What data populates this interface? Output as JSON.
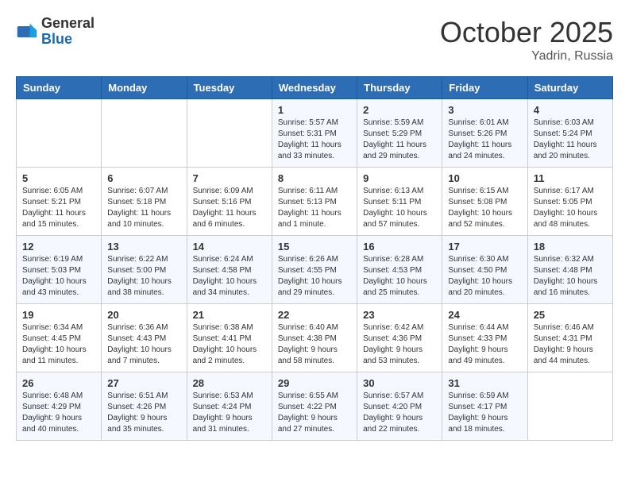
{
  "logo": {
    "general": "General",
    "blue": "Blue"
  },
  "title": "October 2025",
  "location": "Yadrin, Russia",
  "days_of_week": [
    "Sunday",
    "Monday",
    "Tuesday",
    "Wednesday",
    "Thursday",
    "Friday",
    "Saturday"
  ],
  "weeks": [
    [
      {
        "day": "",
        "info": ""
      },
      {
        "day": "",
        "info": ""
      },
      {
        "day": "",
        "info": ""
      },
      {
        "day": "1",
        "info": "Sunrise: 5:57 AM\nSunset: 5:31 PM\nDaylight: 11 hours\nand 33 minutes."
      },
      {
        "day": "2",
        "info": "Sunrise: 5:59 AM\nSunset: 5:29 PM\nDaylight: 11 hours\nand 29 minutes."
      },
      {
        "day": "3",
        "info": "Sunrise: 6:01 AM\nSunset: 5:26 PM\nDaylight: 11 hours\nand 24 minutes."
      },
      {
        "day": "4",
        "info": "Sunrise: 6:03 AM\nSunset: 5:24 PM\nDaylight: 11 hours\nand 20 minutes."
      }
    ],
    [
      {
        "day": "5",
        "info": "Sunrise: 6:05 AM\nSunset: 5:21 PM\nDaylight: 11 hours\nand 15 minutes."
      },
      {
        "day": "6",
        "info": "Sunrise: 6:07 AM\nSunset: 5:18 PM\nDaylight: 11 hours\nand 10 minutes."
      },
      {
        "day": "7",
        "info": "Sunrise: 6:09 AM\nSunset: 5:16 PM\nDaylight: 11 hours\nand 6 minutes."
      },
      {
        "day": "8",
        "info": "Sunrise: 6:11 AM\nSunset: 5:13 PM\nDaylight: 11 hours\nand 1 minute."
      },
      {
        "day": "9",
        "info": "Sunrise: 6:13 AM\nSunset: 5:11 PM\nDaylight: 10 hours\nand 57 minutes."
      },
      {
        "day": "10",
        "info": "Sunrise: 6:15 AM\nSunset: 5:08 PM\nDaylight: 10 hours\nand 52 minutes."
      },
      {
        "day": "11",
        "info": "Sunrise: 6:17 AM\nSunset: 5:05 PM\nDaylight: 10 hours\nand 48 minutes."
      }
    ],
    [
      {
        "day": "12",
        "info": "Sunrise: 6:19 AM\nSunset: 5:03 PM\nDaylight: 10 hours\nand 43 minutes."
      },
      {
        "day": "13",
        "info": "Sunrise: 6:22 AM\nSunset: 5:00 PM\nDaylight: 10 hours\nand 38 minutes."
      },
      {
        "day": "14",
        "info": "Sunrise: 6:24 AM\nSunset: 4:58 PM\nDaylight: 10 hours\nand 34 minutes."
      },
      {
        "day": "15",
        "info": "Sunrise: 6:26 AM\nSunset: 4:55 PM\nDaylight: 10 hours\nand 29 minutes."
      },
      {
        "day": "16",
        "info": "Sunrise: 6:28 AM\nSunset: 4:53 PM\nDaylight: 10 hours\nand 25 minutes."
      },
      {
        "day": "17",
        "info": "Sunrise: 6:30 AM\nSunset: 4:50 PM\nDaylight: 10 hours\nand 20 minutes."
      },
      {
        "day": "18",
        "info": "Sunrise: 6:32 AM\nSunset: 4:48 PM\nDaylight: 10 hours\nand 16 minutes."
      }
    ],
    [
      {
        "day": "19",
        "info": "Sunrise: 6:34 AM\nSunset: 4:45 PM\nDaylight: 10 hours\nand 11 minutes."
      },
      {
        "day": "20",
        "info": "Sunrise: 6:36 AM\nSunset: 4:43 PM\nDaylight: 10 hours\nand 7 minutes."
      },
      {
        "day": "21",
        "info": "Sunrise: 6:38 AM\nSunset: 4:41 PM\nDaylight: 10 hours\nand 2 minutes."
      },
      {
        "day": "22",
        "info": "Sunrise: 6:40 AM\nSunset: 4:38 PM\nDaylight: 9 hours\nand 58 minutes."
      },
      {
        "day": "23",
        "info": "Sunrise: 6:42 AM\nSunset: 4:36 PM\nDaylight: 9 hours\nand 53 minutes."
      },
      {
        "day": "24",
        "info": "Sunrise: 6:44 AM\nSunset: 4:33 PM\nDaylight: 9 hours\nand 49 minutes."
      },
      {
        "day": "25",
        "info": "Sunrise: 6:46 AM\nSunset: 4:31 PM\nDaylight: 9 hours\nand 44 minutes."
      }
    ],
    [
      {
        "day": "26",
        "info": "Sunrise: 6:48 AM\nSunset: 4:29 PM\nDaylight: 9 hours\nand 40 minutes."
      },
      {
        "day": "27",
        "info": "Sunrise: 6:51 AM\nSunset: 4:26 PM\nDaylight: 9 hours\nand 35 minutes."
      },
      {
        "day": "28",
        "info": "Sunrise: 6:53 AM\nSunset: 4:24 PM\nDaylight: 9 hours\nand 31 minutes."
      },
      {
        "day": "29",
        "info": "Sunrise: 6:55 AM\nSunset: 4:22 PM\nDaylight: 9 hours\nand 27 minutes."
      },
      {
        "day": "30",
        "info": "Sunrise: 6:57 AM\nSunset: 4:20 PM\nDaylight: 9 hours\nand 22 minutes."
      },
      {
        "day": "31",
        "info": "Sunrise: 6:59 AM\nSunset: 4:17 PM\nDaylight: 9 hours\nand 18 minutes."
      },
      {
        "day": "",
        "info": ""
      }
    ]
  ]
}
